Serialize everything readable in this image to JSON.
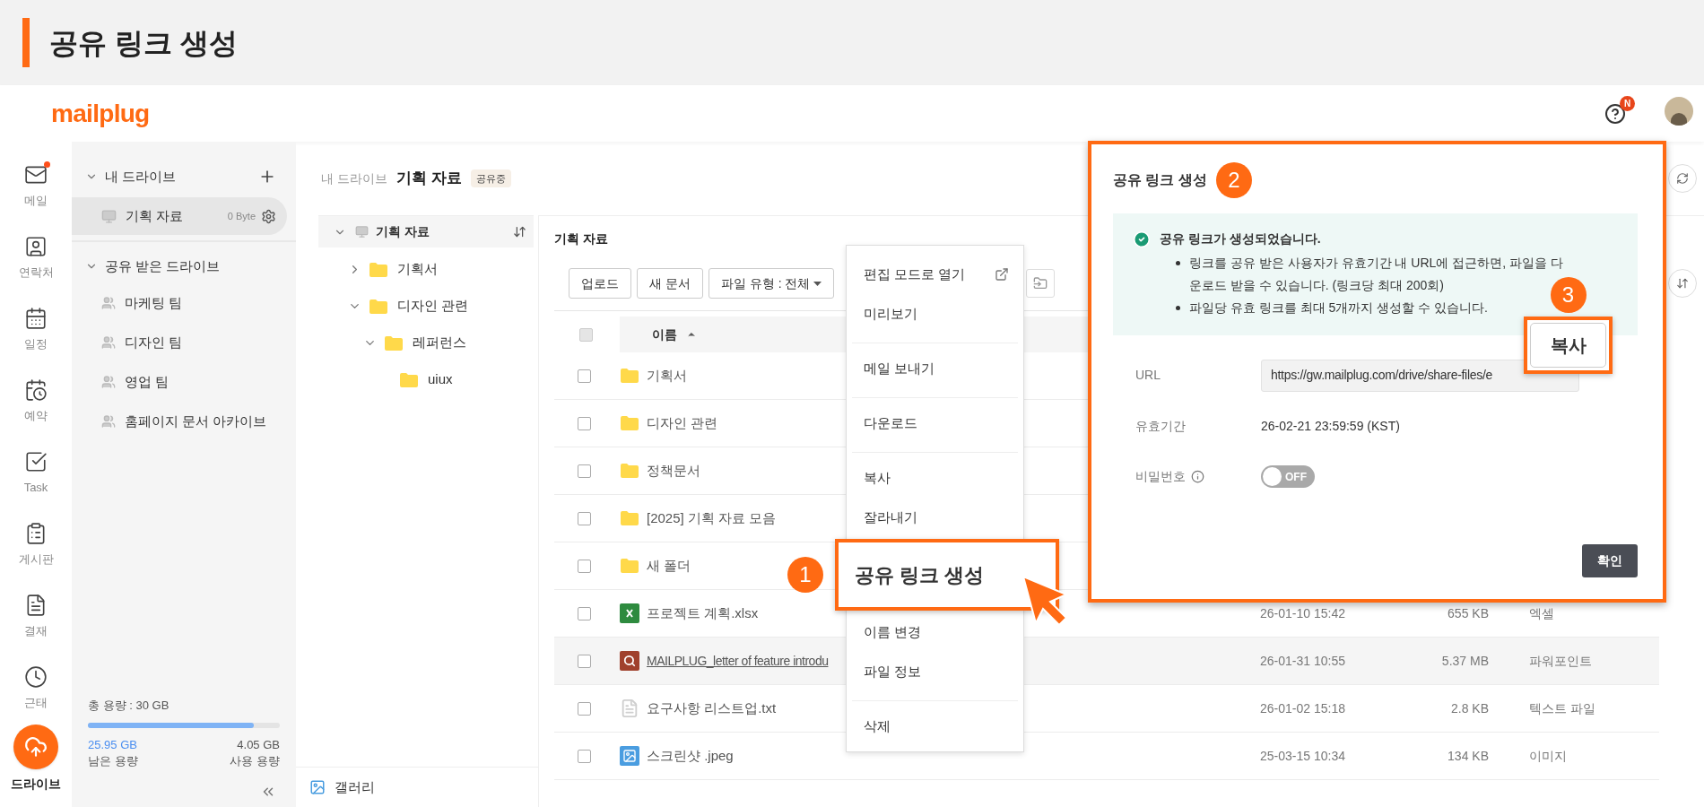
{
  "page_title": "공유 링크 생성",
  "app": {
    "logo": "mailplug",
    "help_badge": "N"
  },
  "rail": [
    {
      "label": "메일",
      "selected": false,
      "notify": true
    },
    {
      "label": "연락처",
      "selected": false,
      "notify": false
    },
    {
      "label": "일정",
      "selected": false,
      "notify": false
    },
    {
      "label": "예약",
      "selected": false,
      "notify": false
    },
    {
      "label": "Task",
      "selected": false,
      "notify": false
    },
    {
      "label": "게시판",
      "selected": false,
      "notify": false
    },
    {
      "label": "결재",
      "selected": false,
      "notify": false
    },
    {
      "label": "근태",
      "selected": false,
      "notify": false
    },
    {
      "label": "드라이브",
      "selected": true,
      "notify": false
    }
  ],
  "sidebar": {
    "my_drive": {
      "title": "내 드라이브",
      "expanded": true,
      "items": [
        {
          "label": "기획 자료",
          "size": "0 Byte",
          "selected": true
        }
      ]
    },
    "shared": {
      "title": "공유 받은 드라이브",
      "expanded": true,
      "items": [
        {
          "label": "마케팅 팀",
          "selected": false
        },
        {
          "label": "디자인 팀",
          "selected": false
        },
        {
          "label": "영업 팀",
          "selected": false
        },
        {
          "label": "홈페이지 문서 아카이브",
          "selected": false
        }
      ]
    },
    "storage": {
      "total": "총 용량 : 30 GB",
      "level": 0.865,
      "free": "25.95 GB",
      "free_label": "남은 용량",
      "used": "4.05 GB",
      "used_label": "사용 용량"
    }
  },
  "breadcrumb": {
    "parent": "내 드라이브",
    "current": "기획 자료",
    "badge": "공유중"
  },
  "tree": {
    "label": "기획 자료",
    "expanded": true,
    "children": [
      {
        "label": "기획서",
        "expanded": false
      },
      {
        "label": "디자인 관련",
        "expanded": true,
        "children": [
          {
            "label": "레퍼런스",
            "expanded": true,
            "children": [
              {
                "label": "uiux"
              }
            ]
          }
        ]
      }
    ]
  },
  "gallery": "갤러리",
  "main": {
    "title": "기획 자료",
    "buttons": [
      "업로드",
      "새 문서"
    ],
    "filter": "파일 유형 : 전체",
    "name_column": "이름",
    "select_all": {
      "disabled": true
    },
    "rows": [
      {
        "name": "기획서",
        "kind": "folder",
        "selected": false
      },
      {
        "name": "디자인 관련",
        "kind": "folder",
        "selected": false
      },
      {
        "name": "정책문서",
        "kind": "folder",
        "selected": false
      },
      {
        "name": "[2025] 기획 자료 모음",
        "kind": "folder",
        "selected": false
      },
      {
        "name": "새 폴더",
        "kind": "folder",
        "selected": false
      },
      {
        "name": "프로젝트 계획.xlsx",
        "kind": "excel",
        "date": "26-01-10 15:42",
        "size": "655 KB",
        "type": "엑셀",
        "selected": false
      },
      {
        "name": "MAILPLUG_letter of feature introdu",
        "kind": "ppt",
        "date": "26-01-31 10:55",
        "size": "5.37 MB",
        "type": "파워포인트",
        "selected": true
      },
      {
        "name": "요구사항 리스트업.txt",
        "kind": "text",
        "date": "26-01-02 15:18",
        "size": "2.8 KB",
        "type": "텍스트 파일",
        "selected": false
      },
      {
        "name": "스크린샷 .jpeg",
        "kind": "image",
        "date": "25-03-15 10:34",
        "size": "134 KB",
        "type": "이미지",
        "selected": false
      }
    ]
  },
  "context_menu": {
    "groups": [
      [
        {
          "label": "편집 모드로 열기",
          "external": true,
          "highlighted": false
        },
        {
          "label": "미리보기",
          "external": false,
          "highlighted": false
        }
      ],
      [
        {
          "label": "메일 보내기",
          "external": false,
          "highlighted": false
        }
      ],
      [
        {
          "label": "다운로드",
          "external": false,
          "highlighted": false
        }
      ],
      [
        {
          "label": "복사",
          "external": false,
          "highlighted": false
        },
        {
          "label": "잘라내기",
          "external": false,
          "highlighted": false
        },
        {
          "label": "공유 링크 생성",
          "external": false,
          "highlighted": true,
          "step": "1"
        },
        {
          "label": "이름 변경",
          "external": false,
          "highlighted": false
        },
        {
          "label": "파일 정보",
          "external": false,
          "highlighted": false
        }
      ],
      [
        {
          "label": "삭제",
          "external": false,
          "highlighted": false
        }
      ]
    ]
  },
  "dialog": {
    "title": "공유 링크 생성",
    "step": "2",
    "notice": {
      "title": "공유 링크가 생성되었습니다.",
      "bullets": [
        "링크를 공유 받은 사용자가 유효기간 내 URL에 접근하면, 파일을 다운로드 받을 수 있습니다. (링크당 최대 200회)",
        "파일당 유효 링크를 최대 5개까지 생성할 수 있습니다."
      ]
    },
    "url_label": "URL",
    "url": "https://gw.mailplug.com/drive/share-files/e",
    "copy": {
      "label": "복사",
      "step": "3"
    },
    "expiry_label": "유효기간",
    "expiry": "26-02-21 23:59:59 (KST)",
    "password_label": "비밀번호",
    "password": {
      "on": false,
      "off_text": "OFF"
    },
    "confirm": "확인"
  }
}
